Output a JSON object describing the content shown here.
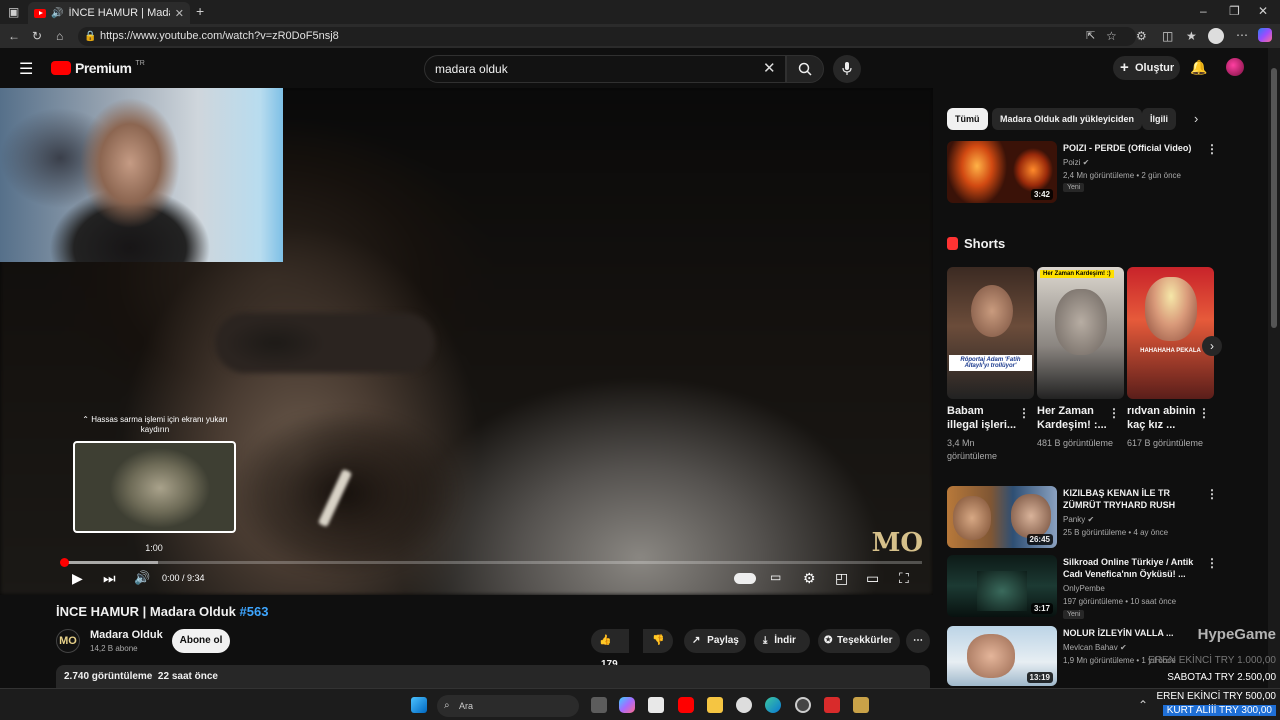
{
  "browser": {
    "tab_title": "İNCE HAMUR | Madara Olduk",
    "url": "https://www.youtube.com/watch?v=zR0DoF5nsj8"
  },
  "youtube": {
    "logo_text": "Premium",
    "logo_region": "TR",
    "search_value": "madara olduk",
    "create_label": "Oluştur"
  },
  "player": {
    "scrub_hint": "⌃ Hassas sarma işlemi için ekranı yukarı kaydırın",
    "preview_time": "1:00",
    "time_display": "0:00 / 9:34",
    "watermark": "MO",
    "progress_played_fraction": 0.0,
    "progress_buffered_fraction": 0.11
  },
  "video": {
    "title": "İNCE HAMUR | Madara Olduk",
    "title_tag": "#563",
    "channel_name": "Madara Olduk",
    "channel_subs": "14,2 B abone",
    "channel_avatar": "MO",
    "subscribe_label": "Abone ol",
    "like_count": "179",
    "share_label": "Paylaş",
    "download_label": "İndir",
    "thanks_label": "Teşekkürler",
    "description_meta": "2.740 görüntüleme  22 saat önce"
  },
  "sidebar": {
    "chips": [
      "Tümü",
      "Madara Olduk adlı yükleyiciden",
      "İlgili"
    ],
    "top_video": {
      "title": "POIZI - PERDE (Official Video)",
      "channel": "Poizi",
      "meta": "2,4 Mn görüntüleme • 2 gün önce",
      "badge": "Yeni",
      "duration": "3:42"
    },
    "shorts_heading": "Shorts",
    "shorts": [
      {
        "title": "Babam illegal işleri...",
        "views": "3,4 Mn görüntüleme",
        "caption": "Röportaj Adam 'Fatih Altaylı'yı trollüyor'"
      },
      {
        "title": "Her Zaman Kardeşim! :...",
        "views": "481 B görüntüleme",
        "caption": "Her Zaman Kardeşim! :)"
      },
      {
        "title": "rıdvan abinin kaç kız ...",
        "views": "617 B görüntüleme",
        "caption": "HAHAHAHA PEKALA"
      }
    ],
    "videos": [
      {
        "title": "KIZILBAŞ KENAN İLE TR ZÜMRÜT TRYHARD RUSH",
        "channel": "Panky",
        "meta": "25 B görüntüleme • 4 ay önce",
        "duration": "26:45",
        "badge": ""
      },
      {
        "title": "Silkroad Online Türkiye / Antik Cadı Venefica'nın Öyküsü! ...",
        "channel": "OnlyPembe",
        "meta": "197 görüntüleme • 10 saat önce",
        "duration": "3:17",
        "badge": "Yeni"
      },
      {
        "title": "NOLUR İZLEYİN VALLA ...",
        "channel": "Mevlcan Bahav",
        "meta": "1,9 Mn görüntüleme • 1 yıl önce",
        "duration": "13:19",
        "badge": ""
      }
    ]
  },
  "taskbar": {
    "search_placeholder": "Ara"
  },
  "stream_overlay": {
    "brand": "HypeGame",
    "donations": [
      {
        "text": "EREN EKİNCİ  TRY 1.000,00"
      },
      {
        "text": "SABOTAJ  TRY 2.500,00"
      },
      {
        "text": "EREN EKİNCİ  TRY 500,00"
      },
      {
        "text": "KURT ALİİİ  TRY 300,00"
      }
    ]
  },
  "colors": {
    "accent_red": "#ff0000",
    "link_blue": "#3ea6ff",
    "background": "#0f0f0f"
  }
}
